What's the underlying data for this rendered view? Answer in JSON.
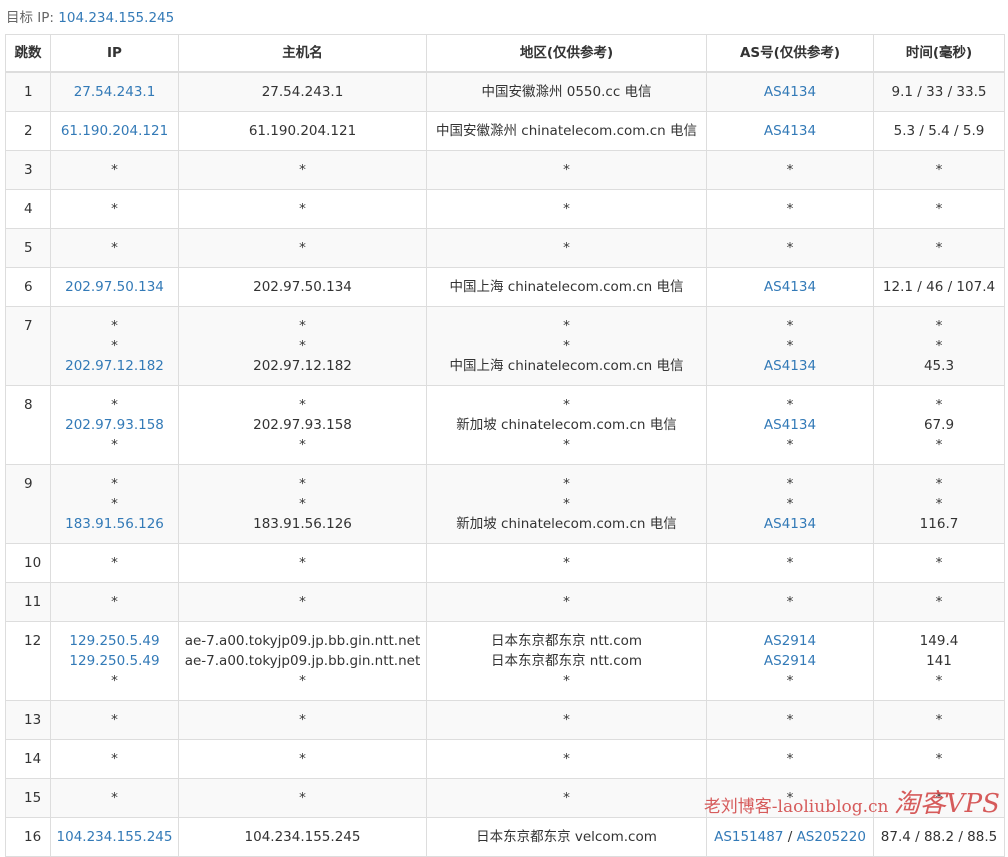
{
  "target": {
    "label": "目标 IP:",
    "ip": "104.234.155.245"
  },
  "headers": [
    "跳数",
    "IP",
    "主机名",
    "地区(仅供参考)",
    "AS号(仅供参考)",
    "时间(毫秒)"
  ],
  "hops": [
    {
      "hop": "1",
      "lines": [
        {
          "ip": "27.54.243.1",
          "host": "27.54.243.1",
          "region": "中国安徽滁州 0550.cc 电信",
          "as": [
            "AS4134"
          ],
          "time": "9.1 / 33 / 33.5"
        }
      ]
    },
    {
      "hop": "2",
      "lines": [
        {
          "ip": "61.190.204.121",
          "host": "61.190.204.121",
          "region": "中国安徽滁州 chinatelecom.com.cn 电信",
          "as": [
            "AS4134"
          ],
          "time": "5.3 / 5.4 / 5.9"
        }
      ]
    },
    {
      "hop": "3",
      "lines": [
        {
          "ip": "*",
          "host": "*",
          "region": "*",
          "as": [],
          "time": "*"
        }
      ]
    },
    {
      "hop": "4",
      "lines": [
        {
          "ip": "*",
          "host": "*",
          "region": "*",
          "as": [],
          "time": "*"
        }
      ]
    },
    {
      "hop": "5",
      "lines": [
        {
          "ip": "*",
          "host": "*",
          "region": "*",
          "as": [],
          "time": "*"
        }
      ]
    },
    {
      "hop": "6",
      "lines": [
        {
          "ip": "202.97.50.134",
          "host": "202.97.50.134",
          "region": "中国上海 chinatelecom.com.cn 电信",
          "as": [
            "AS4134"
          ],
          "time": "12.1 / 46 / 107.4"
        }
      ]
    },
    {
      "hop": "7",
      "lines": [
        {
          "ip": "*",
          "host": "*",
          "region": "*",
          "as": [],
          "time": "*"
        },
        {
          "ip": "*",
          "host": "*",
          "region": "*",
          "as": [],
          "time": "*"
        },
        {
          "ip": "202.97.12.182",
          "host": "202.97.12.182",
          "region": "中国上海 chinatelecom.com.cn 电信",
          "as": [
            "AS4134"
          ],
          "time": "45.3"
        }
      ]
    },
    {
      "hop": "8",
      "lines": [
        {
          "ip": "*",
          "host": "*",
          "region": "*",
          "as": [],
          "time": "*"
        },
        {
          "ip": "202.97.93.158",
          "host": "202.97.93.158",
          "region": "新加坡 chinatelecom.com.cn 电信",
          "as": [
            "AS4134"
          ],
          "time": "67.9"
        },
        {
          "ip": "*",
          "host": "*",
          "region": "*",
          "as": [],
          "time": "*"
        }
      ]
    },
    {
      "hop": "9",
      "lines": [
        {
          "ip": "*",
          "host": "*",
          "region": "*",
          "as": [],
          "time": "*"
        },
        {
          "ip": "*",
          "host": "*",
          "region": "*",
          "as": [],
          "time": "*"
        },
        {
          "ip": "183.91.56.126",
          "host": "183.91.56.126",
          "region": "新加坡 chinatelecom.com.cn 电信",
          "as": [
            "AS4134"
          ],
          "time": "116.7"
        }
      ]
    },
    {
      "hop": "10",
      "lines": [
        {
          "ip": "*",
          "host": "*",
          "region": "*",
          "as": [],
          "time": "*"
        }
      ]
    },
    {
      "hop": "11",
      "lines": [
        {
          "ip": "*",
          "host": "*",
          "region": "*",
          "as": [],
          "time": "*"
        }
      ]
    },
    {
      "hop": "12",
      "lines": [
        {
          "ip": "129.250.5.49",
          "host": "ae-7.a00.tokyjp09.jp.bb.gin.ntt.net",
          "region": "日本东京都东京 ntt.com",
          "as": [
            "AS2914"
          ],
          "time": "149.4"
        },
        {
          "ip": "129.250.5.49",
          "host": "ae-7.a00.tokyjp09.jp.bb.gin.ntt.net",
          "region": "日本东京都东京 ntt.com",
          "as": [
            "AS2914"
          ],
          "time": "141"
        },
        {
          "ip": "*",
          "host": "*",
          "region": "*",
          "as": [],
          "time": "*"
        }
      ]
    },
    {
      "hop": "13",
      "lines": [
        {
          "ip": "*",
          "host": "*",
          "region": "*",
          "as": [],
          "time": "*"
        }
      ]
    },
    {
      "hop": "14",
      "lines": [
        {
          "ip": "*",
          "host": "*",
          "region": "*",
          "as": [],
          "time": "*"
        }
      ]
    },
    {
      "hop": "15",
      "lines": [
        {
          "ip": "*",
          "host": "*",
          "region": "*",
          "as": [],
          "time": "*"
        }
      ]
    },
    {
      "hop": "16",
      "lines": [
        {
          "ip": "104.234.155.245",
          "host": "104.234.155.245",
          "region": "日本东京都东京 velcom.com",
          "as": [
            "AS151487",
            "AS205220"
          ],
          "time": "87.4 / 88.2 / 88.5"
        }
      ]
    }
  ],
  "watermark": {
    "text": "老刘博客-laoliublog.cn",
    "brand": "淘客VPS"
  }
}
